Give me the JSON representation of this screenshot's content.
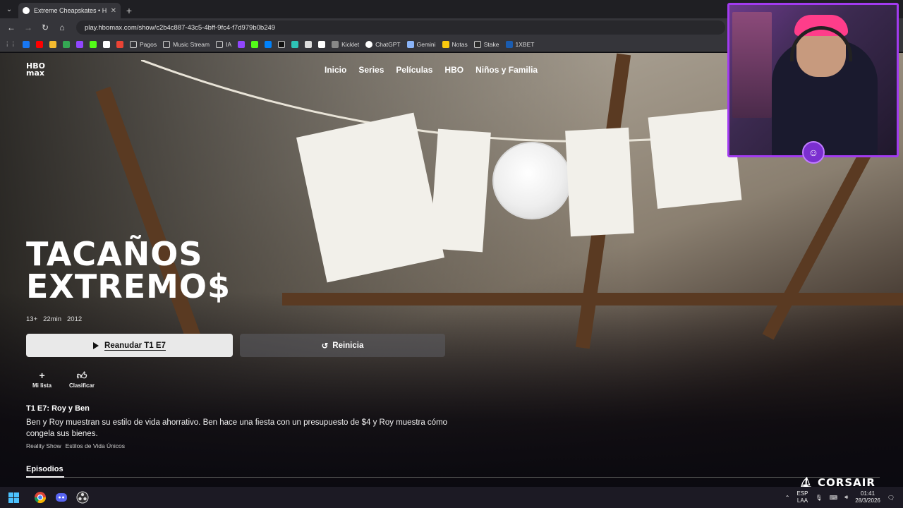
{
  "browser": {
    "tab_title": "Extreme Cheapskates • HBO Max",
    "url": "play.hbomax.com/show/c2b4c887-43c5-4bff-9fc4-f7d979b0b249",
    "bookmarks": [
      "Pagos",
      "Music Stream",
      "IA",
      "Kicklet",
      "ChatGPT",
      "Gemini",
      "Notas",
      "Stake",
      "1XBET"
    ]
  },
  "site": {
    "logo_top": "HBO",
    "logo_bottom": "max",
    "nav": [
      "Inicio",
      "Series",
      "Películas",
      "HBO",
      "Niños y Familia"
    ]
  },
  "show": {
    "title_line1": "TACAÑOS",
    "title_line2": "EXTREMO$",
    "rating": "13+",
    "duration": "22min",
    "year": "2012",
    "resume_label": "Reanudar T1 E7",
    "restart_label": "Reinicia",
    "my_list_label": "Mi lista",
    "rate_label": "Clasificar",
    "episode_title": "T1 E7: Roy y Ben",
    "episode_description": "Ben y Roy muestran su estilo de vida ahorrativo. Ben hace una fiesta con un presupuesto de $4 y Roy muestra cómo congela sus bienes.",
    "genres": [
      "Reality Show",
      "Estilos de Vida Únicos"
    ],
    "episodes_tab": "Episodios"
  },
  "overlay": {
    "brand": "CORSAIR"
  },
  "taskbar": {
    "lang_top": "ESP",
    "lang_bottom": "LAA",
    "time": "01:41",
    "date": "28/3/2026"
  }
}
